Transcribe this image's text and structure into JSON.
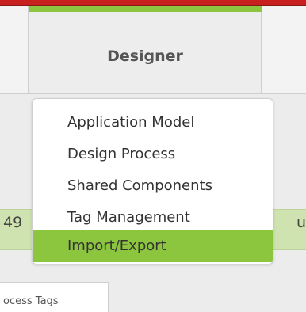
{
  "header": {
    "active_tab": "Designer"
  },
  "menu": {
    "items": [
      {
        "label": "Application Model",
        "selected": false
      },
      {
        "label": "Design Process",
        "selected": false
      },
      {
        "label": "Shared Components",
        "selected": false
      },
      {
        "label": "Tag Management",
        "selected": false
      },
      {
        "label": "Import/Export",
        "selected": true
      }
    ]
  },
  "background": {
    "row_left_text": "49",
    "row_right_text": "u",
    "bottom_tab_label": "ocess Tags"
  },
  "colors": {
    "top_bar": "#c8201f",
    "accent_green": "#8cc63f",
    "menu_bg": "#ffffff"
  }
}
